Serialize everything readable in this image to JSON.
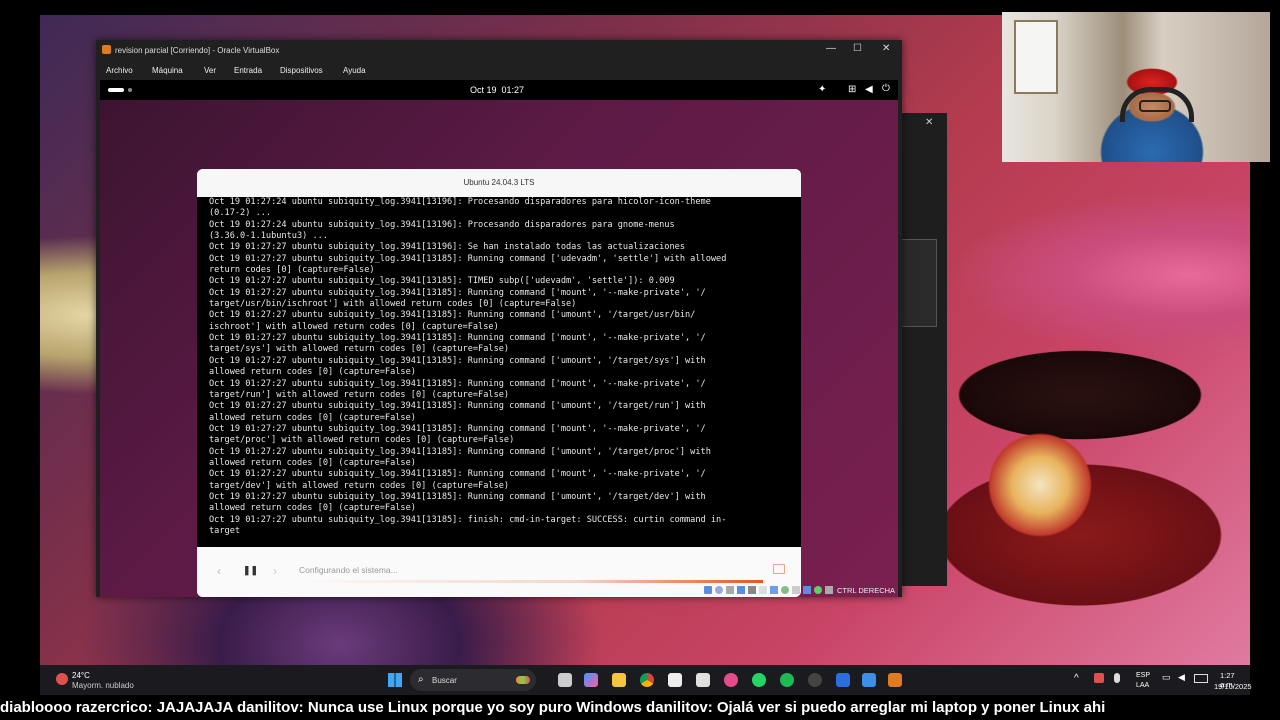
{
  "vbox": {
    "title": "revision parcial [Corriendo] - Oracle VirtualBox",
    "menu": [
      "Archivo",
      "Máquina",
      "Ver",
      "Entrada",
      "Dispositivos",
      "Ayuda"
    ],
    "host_key": "CTRL DERECHA"
  },
  "guest": {
    "clock": "Oct 19  01:27",
    "installer_title": "Ubuntu 24.04.3 LTS",
    "status": "Configurando el sistema...",
    "log_lines": [
      "Oct 19 01:27:24 ubuntu subiquity_log.3941[13196]: Procesando disparadores para hicolor-icon-theme",
      "(0.17-2) ...",
      "Oct 19 01:27:24 ubuntu subiquity_log.3941[13196]: Procesando disparadores para gnome-menus",
      "(3.36.0-1.1ubuntu3) ...",
      "Oct 19 01:27:27 ubuntu subiquity_log.3941[13196]: Se han instalado todas las actualizaciones",
      "Oct 19 01:27:27 ubuntu subiquity_log.3941[13185]: Running command ['udevadm', 'settle'] with allowed",
      "return codes [0] (capture=False)",
      "Oct 19 01:27:27 ubuntu subiquity_log.3941[13185]: TIMED subp(['udevadm', 'settle']): 0.009",
      "Oct 19 01:27:27 ubuntu subiquity_log.3941[13185]: Running command ['mount', '--make-private', '/",
      "target/usr/bin/ischroot'] with allowed return codes [0] (capture=False)",
      "Oct 19 01:27:27 ubuntu subiquity_log.3941[13185]: Running command ['umount', '/target/usr/bin/",
      "ischroot'] with allowed return codes [0] (capture=False)",
      "Oct 19 01:27:27 ubuntu subiquity_log.3941[13185]: Running command ['mount', '--make-private', '/",
      "target/sys'] with allowed return codes [0] (capture=False)",
      "Oct 19 01:27:27 ubuntu subiquity_log.3941[13185]: Running command ['umount', '/target/sys'] with",
      "allowed return codes [0] (capture=False)",
      "Oct 19 01:27:27 ubuntu subiquity_log.3941[13185]: Running command ['mount', '--make-private', '/",
      "target/run'] with allowed return codes [0] (capture=False)",
      "Oct 19 01:27:27 ubuntu subiquity_log.3941[13185]: Running command ['umount', '/target/run'] with",
      "allowed return codes [0] (capture=False)",
      "Oct 19 01:27:27 ubuntu subiquity_log.3941[13185]: Running command ['mount', '--make-private', '/",
      "target/proc'] with allowed return codes [0] (capture=False)",
      "Oct 19 01:27:27 ubuntu subiquity_log.3941[13185]: Running command ['umount', '/target/proc'] with",
      "allowed return codes [0] (capture=False)",
      "Oct 19 01:27:27 ubuntu subiquity_log.3941[13185]: Running command ['mount', '--make-private', '/",
      "target/dev'] with allowed return codes [0] (capture=False)",
      "Oct 19 01:27:27 ubuntu subiquity_log.3941[13185]: Running command ['umount', '/target/dev'] with",
      "allowed return codes [0] (capture=False)",
      "Oct 19 01:27:27 ubuntu subiquity_log.3941[13185]: finish: cmd-in-target: SUCCESS: curtin command in-",
      "target"
    ]
  },
  "taskbar": {
    "weather_temp": "24°C",
    "weather_desc": "Mayorm. nublado",
    "search_placeholder": "Buscar",
    "lang_line1": "ESP",
    "lang_line2": "LAA",
    "time": "1:27 a.m.",
    "date": "19/10/2025"
  },
  "chat_ticker": "diabloooo razercrico: JAJAJAJA danilitov: Nunca use Linux porque yo soy puro Windows danilitov: Ojalá ver si puedo arreglar mi laptop y poner Linux ahi",
  "colors": {
    "ubuntu_orange": "#E95420",
    "vbox_dark": "#202020",
    "taskbar": "#1b1b1f"
  }
}
